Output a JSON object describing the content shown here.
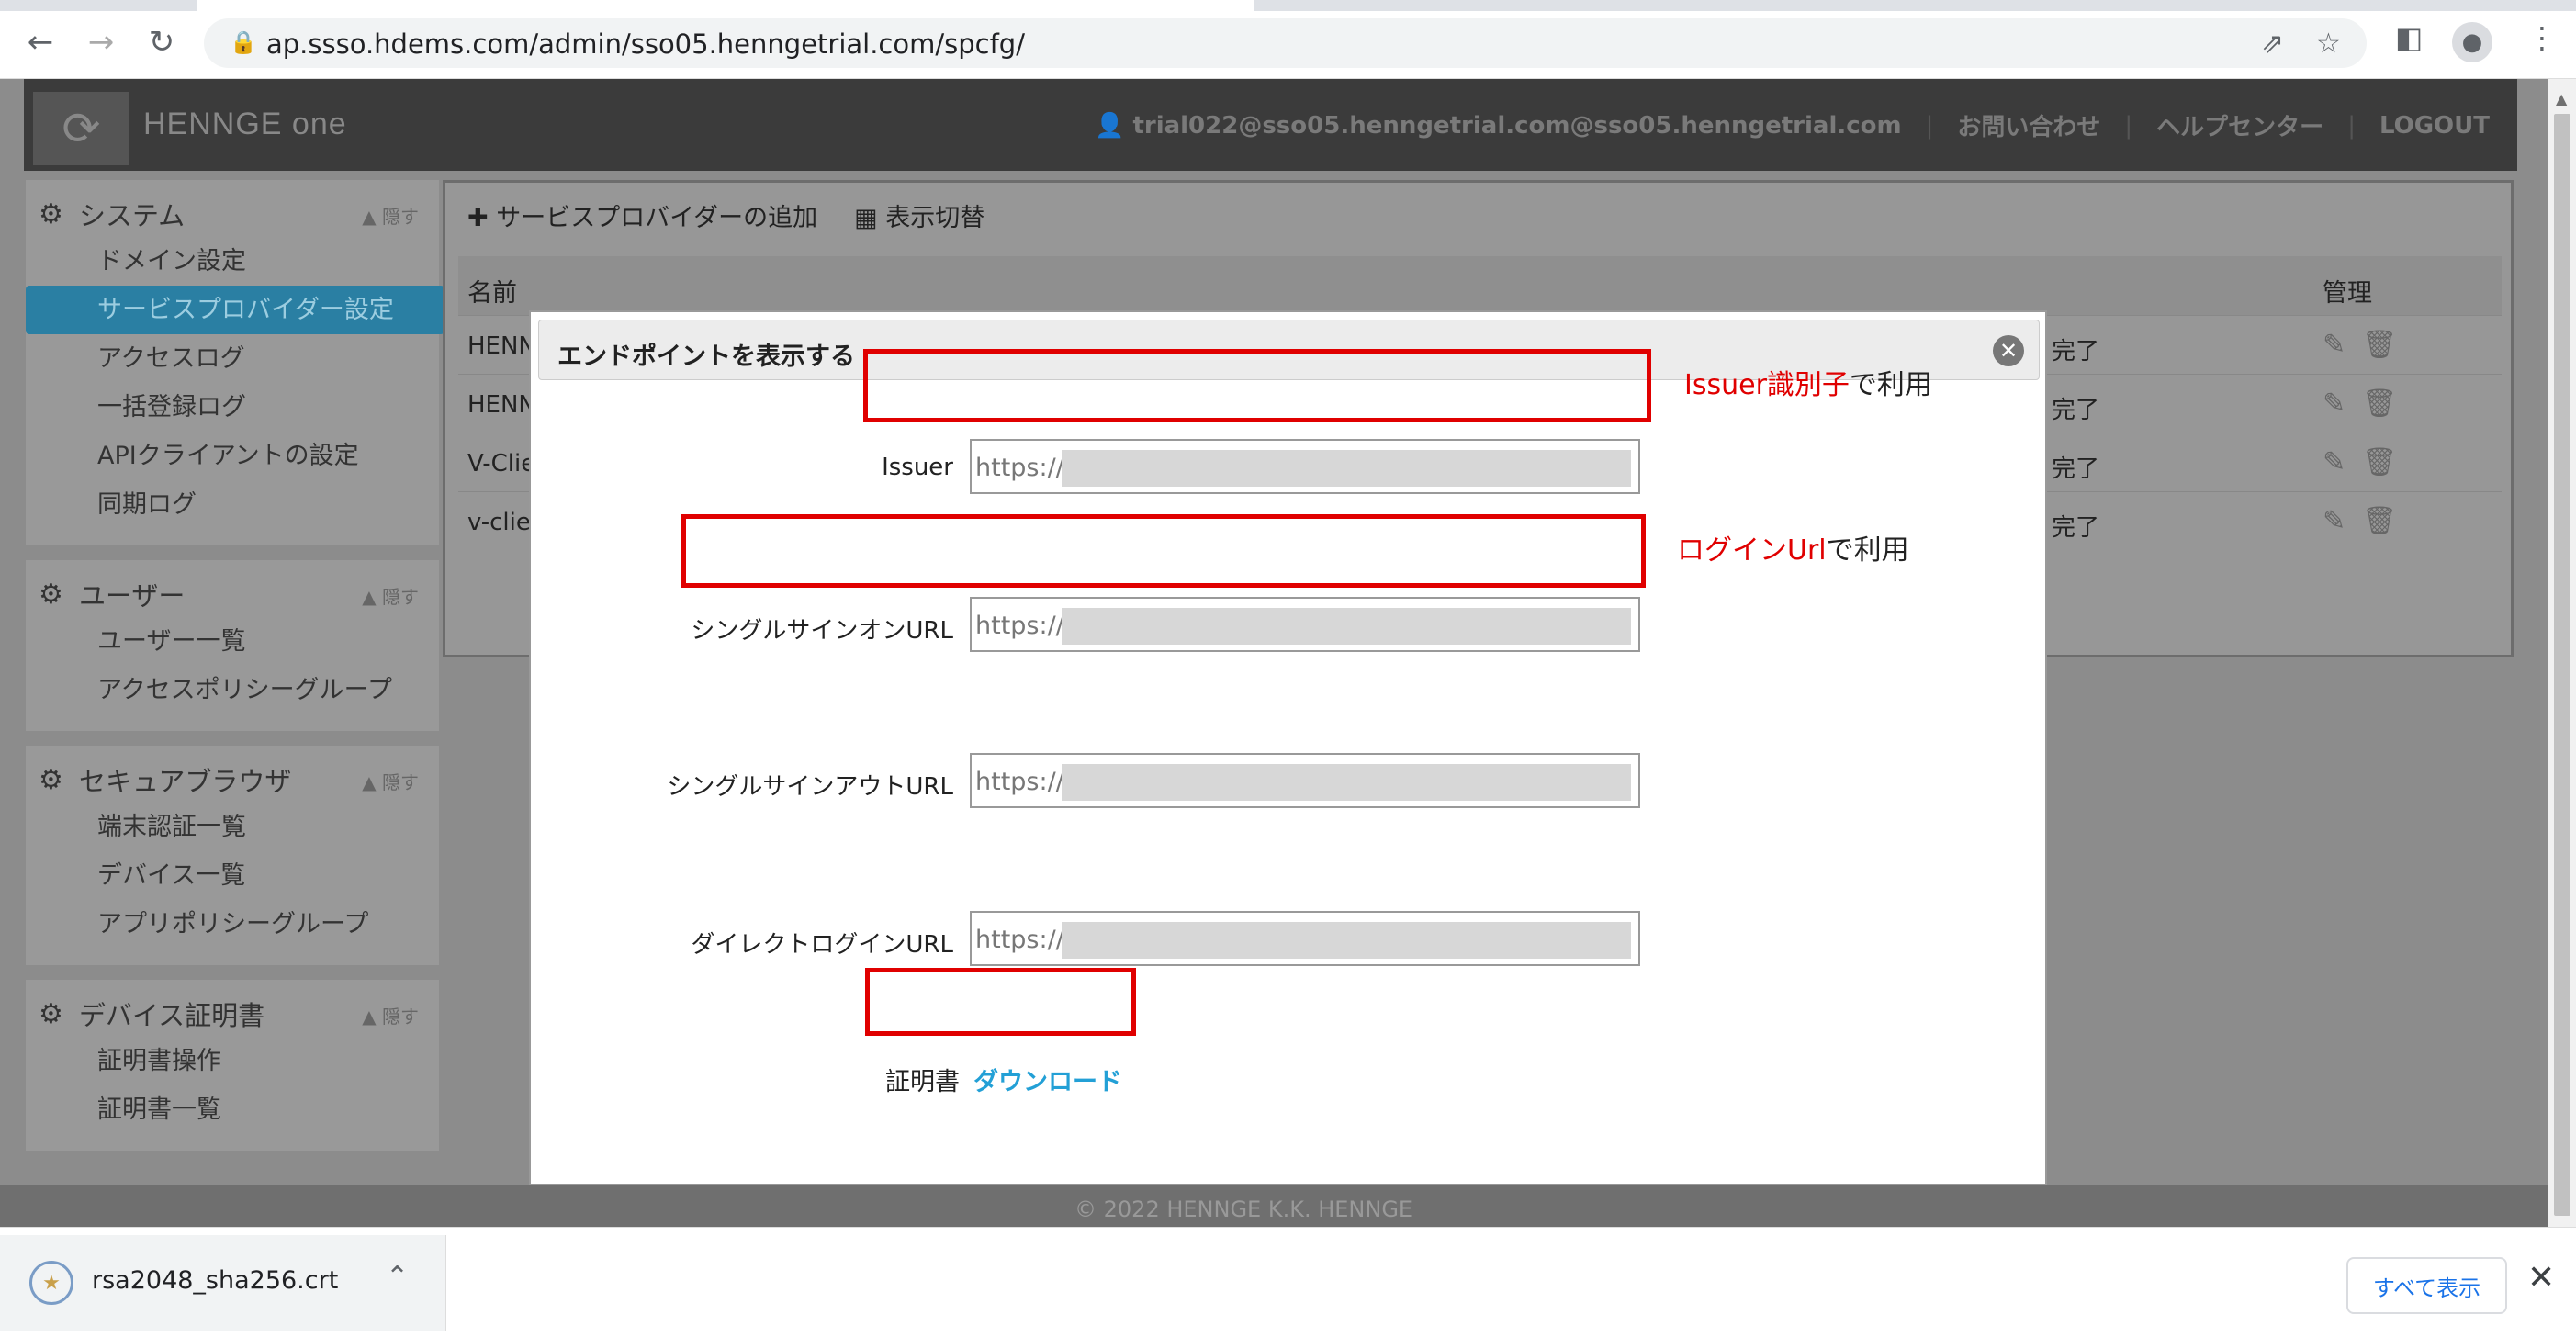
{
  "browser": {
    "url": "ap.ssso.hdems.com/admin/sso05.henngetrial.com/spcfg/",
    "icons": [
      "back-icon",
      "forward-icon",
      "reload-icon",
      "lock-icon",
      "share-icon",
      "star-icon",
      "sidepanel-icon",
      "profile-icon",
      "menu-icon"
    ]
  },
  "header": {
    "brand": "HENNGE one",
    "user": "trial022@sso05.henngetrial.com@sso05.henngetrial.com",
    "contact": "お問い合わせ",
    "help": "ヘルプセンター",
    "logout": "LOGOUT"
  },
  "sidebar": {
    "hide_label": "隠す",
    "groups": [
      {
        "title": "システム",
        "items": [
          "ドメイン設定",
          "サービスプロバイダー設定",
          "アクセスログ",
          "一括登録ログ",
          "APIクライアントの設定",
          "同期ログ"
        ]
      },
      {
        "title": "ユーザー",
        "items": [
          "ユーザー一覧",
          "アクセスポリシーグループ"
        ]
      },
      {
        "title": "セキュアブラウザ",
        "items": [
          "端末認証一覧",
          "デバイス一覧",
          "アプリポリシーグループ"
        ]
      },
      {
        "title": "デバイス証明書",
        "items": [
          "証明書操作",
          "証明書一覧"
        ]
      }
    ]
  },
  "toolbar": {
    "add_label": "サービスプロバイダーの追加",
    "view_label": "表示切替"
  },
  "table": {
    "col_name": "名前",
    "col_manage": "管理",
    "rows": [
      {
        "name": "HENN",
        "status": "完了"
      },
      {
        "name": "HENN",
        "status": "完了"
      },
      {
        "name": "V-Clie",
        "status": "完了"
      },
      {
        "name": "v-clie",
        "status": "完了"
      }
    ]
  },
  "footer": {
    "text": "© 2022 HENNGE K.K.   HENNGE"
  },
  "modal": {
    "title": "エンドポイントを表示する",
    "fields": [
      {
        "label": "Issuer",
        "value": "https://"
      },
      {
        "label": "シングルサインオンURL",
        "value": "https://"
      },
      {
        "label": "シングルサインアウトURL",
        "value": "https://"
      },
      {
        "label": "ダイレクトログインURL",
        "value": "https://"
      }
    ],
    "cert_label": "証明書",
    "cert_link": "ダウンロード"
  },
  "annotations": {
    "issuer_red": "Issuer識別子",
    "issuer_black": "で利用",
    "login_red": "ログインUrl",
    "login_black": "で利用",
    "color": "#e00000"
  },
  "download_bar": {
    "filename": "rsa2048_sha256.crt",
    "show_all": "すべて表示"
  }
}
